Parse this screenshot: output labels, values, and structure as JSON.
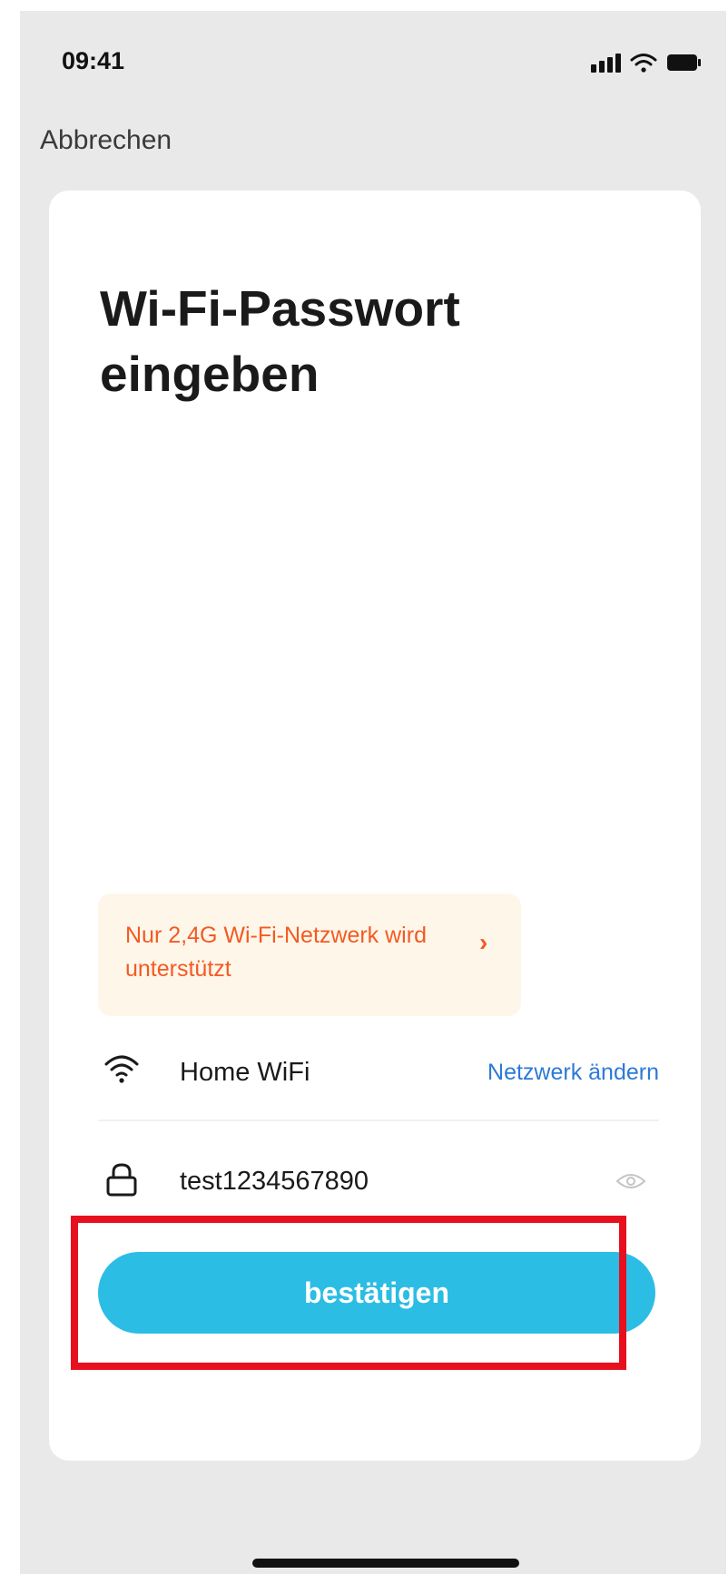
{
  "status_bar": {
    "time": "09:41",
    "icons": [
      "signal-icon",
      "wifi-icon",
      "battery-icon"
    ]
  },
  "header": {
    "cancel_label": "Abbrechen"
  },
  "card": {
    "title": "Wi-Fi-Passwort eingeben",
    "notice": {
      "text": "Nur 2,4G Wi-Fi-Netzwerk wird unterstützt",
      "arrow": "›",
      "text_color": "#f35a22",
      "background": "#fff6ea"
    },
    "network": {
      "icon": "wifi-icon",
      "name": "Home WiFi",
      "change_label": "Netzwerk ändern"
    },
    "password": {
      "icon": "lock-icon",
      "value": "test1234567890",
      "toggle_icon": "eye-icon"
    },
    "confirm_label": "bestätigen"
  },
  "colors": {
    "accent": "#2bbde3",
    "link": "#2c7ad6",
    "highlight": "#e8101e",
    "background": "#e9e9ea"
  }
}
